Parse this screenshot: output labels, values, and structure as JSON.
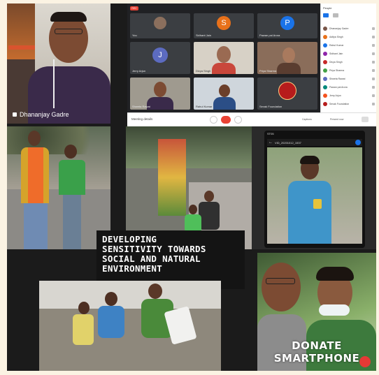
{
  "speaker": {
    "name": "Dhananjay Gadre"
  },
  "meet": {
    "record_badge": "REC",
    "tiles": [
      {
        "label": "You",
        "letter": ""
      },
      {
        "label": "Sidhant Jain",
        "letter": "S"
      },
      {
        "label": "Pawan pal Arora",
        "letter": "P"
      },
      {
        "label": "Jerry Arjun",
        "letter": "J"
      },
      {
        "label": "Divya Singh",
        "letter": ""
      },
      {
        "label": "Priya Sharma",
        "letter": ""
      },
      {
        "label": "Shweta Rawat",
        "letter": ""
      },
      {
        "label": "Rahul Kumar",
        "letter": ""
      },
      {
        "label": "Sevak Foundation",
        "letter": ""
      }
    ],
    "sidebar_title": "People",
    "sidebar_items": [
      "Dhananjay Gadre",
      "Aditya Singh",
      "Rahul Kumar",
      "Sidhant Jain",
      "Divya Singh",
      "Priya Sharma",
      "Shweta Rawat",
      "Pawan pal Arora",
      "Jerry Arjun",
      "Sevak Foundation"
    ],
    "bottom_left": "Meeting details",
    "bottom_right": [
      "Captions",
      "Present now"
    ]
  },
  "phone": {
    "status": "ST05 ",
    "video_title": "VID_20201012_1537"
  },
  "overlay_title": [
    "DEVELOPING",
    "SENSITIVITY TOWARDS",
    "SOCIAL AND NATURAL",
    "ENVIRONMENT"
  ],
  "donate_text": [
    "DONATE",
    "SMARTPHONE"
  ],
  "colors": {
    "page_bg": "#fbf3e3",
    "meet_bg": "#202124",
    "end_call": "#ea4335",
    "accent_blue": "#1a73e8"
  }
}
